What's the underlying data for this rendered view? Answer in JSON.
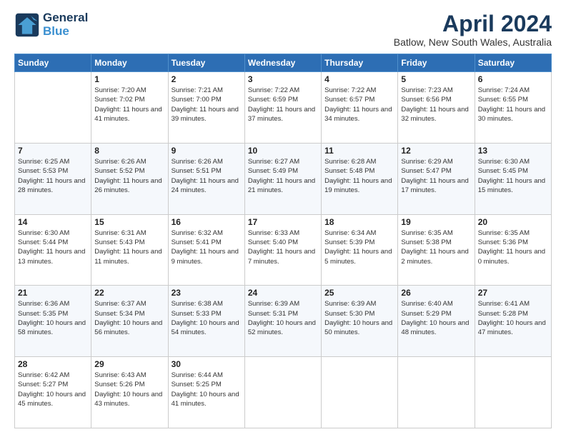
{
  "header": {
    "logo_general": "General",
    "logo_blue": "Blue",
    "main_title": "April 2024",
    "subtitle": "Batlow, New South Wales, Australia"
  },
  "calendar": {
    "days_of_week": [
      "Sunday",
      "Monday",
      "Tuesday",
      "Wednesday",
      "Thursday",
      "Friday",
      "Saturday"
    ],
    "weeks": [
      [
        {
          "day": "",
          "sunrise": "",
          "sunset": "",
          "daylight": ""
        },
        {
          "day": "1",
          "sunrise": "Sunrise: 7:20 AM",
          "sunset": "Sunset: 7:02 PM",
          "daylight": "Daylight: 11 hours and 41 minutes."
        },
        {
          "day": "2",
          "sunrise": "Sunrise: 7:21 AM",
          "sunset": "Sunset: 7:00 PM",
          "daylight": "Daylight: 11 hours and 39 minutes."
        },
        {
          "day": "3",
          "sunrise": "Sunrise: 7:22 AM",
          "sunset": "Sunset: 6:59 PM",
          "daylight": "Daylight: 11 hours and 37 minutes."
        },
        {
          "day": "4",
          "sunrise": "Sunrise: 7:22 AM",
          "sunset": "Sunset: 6:57 PM",
          "daylight": "Daylight: 11 hours and 34 minutes."
        },
        {
          "day": "5",
          "sunrise": "Sunrise: 7:23 AM",
          "sunset": "Sunset: 6:56 PM",
          "daylight": "Daylight: 11 hours and 32 minutes."
        },
        {
          "day": "6",
          "sunrise": "Sunrise: 7:24 AM",
          "sunset": "Sunset: 6:55 PM",
          "daylight": "Daylight: 11 hours and 30 minutes."
        }
      ],
      [
        {
          "day": "7",
          "sunrise": "Sunrise: 6:25 AM",
          "sunset": "Sunset: 5:53 PM",
          "daylight": "Daylight: 11 hours and 28 minutes."
        },
        {
          "day": "8",
          "sunrise": "Sunrise: 6:26 AM",
          "sunset": "Sunset: 5:52 PM",
          "daylight": "Daylight: 11 hours and 26 minutes."
        },
        {
          "day": "9",
          "sunrise": "Sunrise: 6:26 AM",
          "sunset": "Sunset: 5:51 PM",
          "daylight": "Daylight: 11 hours and 24 minutes."
        },
        {
          "day": "10",
          "sunrise": "Sunrise: 6:27 AM",
          "sunset": "Sunset: 5:49 PM",
          "daylight": "Daylight: 11 hours and 21 minutes."
        },
        {
          "day": "11",
          "sunrise": "Sunrise: 6:28 AM",
          "sunset": "Sunset: 5:48 PM",
          "daylight": "Daylight: 11 hours and 19 minutes."
        },
        {
          "day": "12",
          "sunrise": "Sunrise: 6:29 AM",
          "sunset": "Sunset: 5:47 PM",
          "daylight": "Daylight: 11 hours and 17 minutes."
        },
        {
          "day": "13",
          "sunrise": "Sunrise: 6:30 AM",
          "sunset": "Sunset: 5:45 PM",
          "daylight": "Daylight: 11 hours and 15 minutes."
        }
      ],
      [
        {
          "day": "14",
          "sunrise": "Sunrise: 6:30 AM",
          "sunset": "Sunset: 5:44 PM",
          "daylight": "Daylight: 11 hours and 13 minutes."
        },
        {
          "day": "15",
          "sunrise": "Sunrise: 6:31 AM",
          "sunset": "Sunset: 5:43 PM",
          "daylight": "Daylight: 11 hours and 11 minutes."
        },
        {
          "day": "16",
          "sunrise": "Sunrise: 6:32 AM",
          "sunset": "Sunset: 5:41 PM",
          "daylight": "Daylight: 11 hours and 9 minutes."
        },
        {
          "day": "17",
          "sunrise": "Sunrise: 6:33 AM",
          "sunset": "Sunset: 5:40 PM",
          "daylight": "Daylight: 11 hours and 7 minutes."
        },
        {
          "day": "18",
          "sunrise": "Sunrise: 6:34 AM",
          "sunset": "Sunset: 5:39 PM",
          "daylight": "Daylight: 11 hours and 5 minutes."
        },
        {
          "day": "19",
          "sunrise": "Sunrise: 6:35 AM",
          "sunset": "Sunset: 5:38 PM",
          "daylight": "Daylight: 11 hours and 2 minutes."
        },
        {
          "day": "20",
          "sunrise": "Sunrise: 6:35 AM",
          "sunset": "Sunset: 5:36 PM",
          "daylight": "Daylight: 11 hours and 0 minutes."
        }
      ],
      [
        {
          "day": "21",
          "sunrise": "Sunrise: 6:36 AM",
          "sunset": "Sunset: 5:35 PM",
          "daylight": "Daylight: 10 hours and 58 minutes."
        },
        {
          "day": "22",
          "sunrise": "Sunrise: 6:37 AM",
          "sunset": "Sunset: 5:34 PM",
          "daylight": "Daylight: 10 hours and 56 minutes."
        },
        {
          "day": "23",
          "sunrise": "Sunrise: 6:38 AM",
          "sunset": "Sunset: 5:33 PM",
          "daylight": "Daylight: 10 hours and 54 minutes."
        },
        {
          "day": "24",
          "sunrise": "Sunrise: 6:39 AM",
          "sunset": "Sunset: 5:31 PM",
          "daylight": "Daylight: 10 hours and 52 minutes."
        },
        {
          "day": "25",
          "sunrise": "Sunrise: 6:39 AM",
          "sunset": "Sunset: 5:30 PM",
          "daylight": "Daylight: 10 hours and 50 minutes."
        },
        {
          "day": "26",
          "sunrise": "Sunrise: 6:40 AM",
          "sunset": "Sunset: 5:29 PM",
          "daylight": "Daylight: 10 hours and 48 minutes."
        },
        {
          "day": "27",
          "sunrise": "Sunrise: 6:41 AM",
          "sunset": "Sunset: 5:28 PM",
          "daylight": "Daylight: 10 hours and 47 minutes."
        }
      ],
      [
        {
          "day": "28",
          "sunrise": "Sunrise: 6:42 AM",
          "sunset": "Sunset: 5:27 PM",
          "daylight": "Daylight: 10 hours and 45 minutes."
        },
        {
          "day": "29",
          "sunrise": "Sunrise: 6:43 AM",
          "sunset": "Sunset: 5:26 PM",
          "daylight": "Daylight: 10 hours and 43 minutes."
        },
        {
          "day": "30",
          "sunrise": "Sunrise: 6:44 AM",
          "sunset": "Sunset: 5:25 PM",
          "daylight": "Daylight: 10 hours and 41 minutes."
        },
        {
          "day": "",
          "sunrise": "",
          "sunset": "",
          "daylight": ""
        },
        {
          "day": "",
          "sunrise": "",
          "sunset": "",
          "daylight": ""
        },
        {
          "day": "",
          "sunrise": "",
          "sunset": "",
          "daylight": ""
        },
        {
          "day": "",
          "sunrise": "",
          "sunset": "",
          "daylight": ""
        }
      ]
    ]
  }
}
